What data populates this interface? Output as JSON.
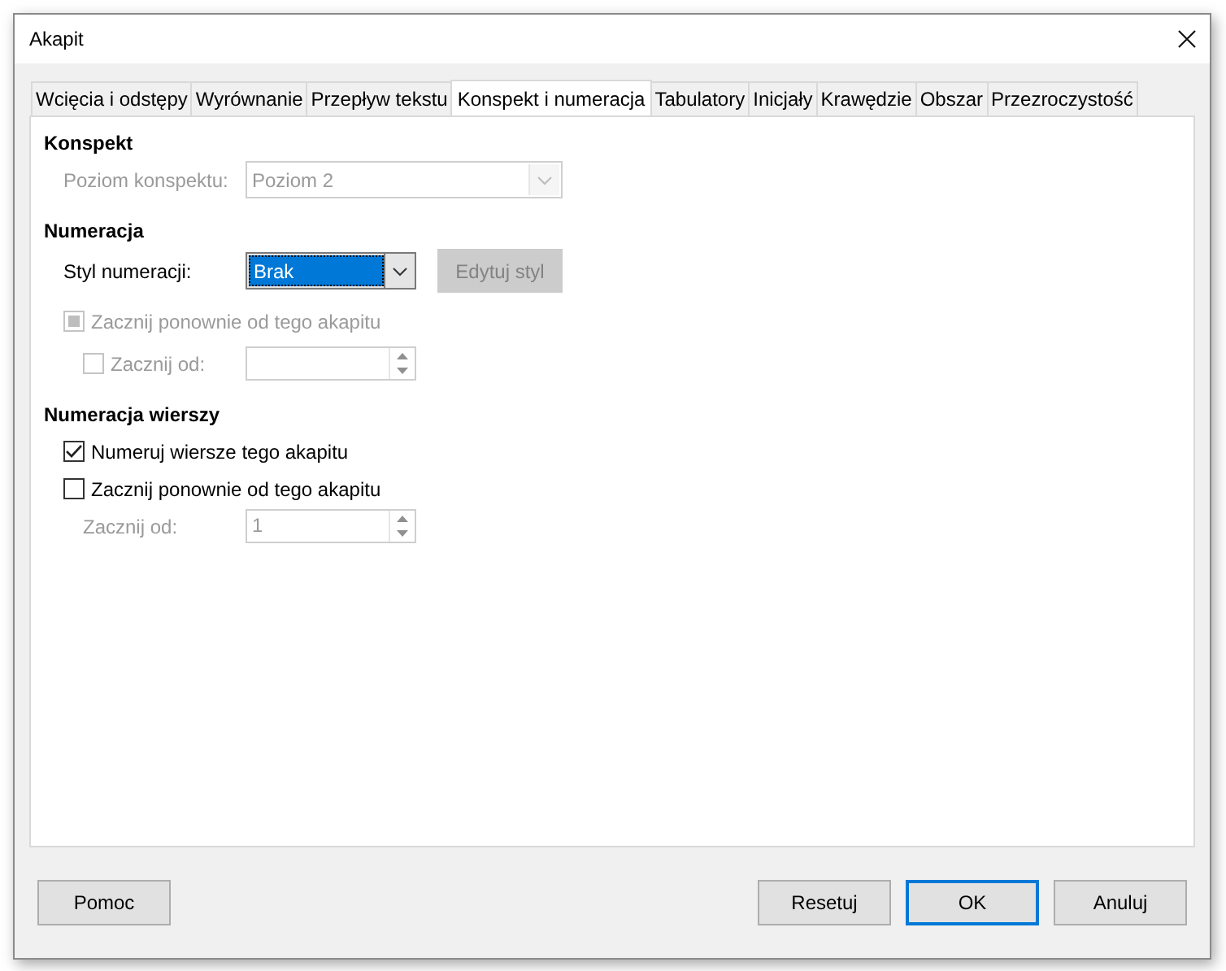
{
  "window": {
    "title": "Akapit"
  },
  "tabs": [
    {
      "label": "Wcięcia i odstępy",
      "selected": false
    },
    {
      "label": "Wyrównanie",
      "selected": false
    },
    {
      "label": "Przepływ tekstu",
      "selected": false
    },
    {
      "label": "Konspekt i numeracja",
      "selected": true
    },
    {
      "label": "Tabulatory",
      "selected": false
    },
    {
      "label": "Inicjały",
      "selected": false
    },
    {
      "label": "Krawędzie",
      "selected": false
    },
    {
      "label": "Obszar",
      "selected": false
    },
    {
      "label": "Przezroczystość",
      "selected": false
    }
  ],
  "sections": [
    {
      "heading": "Konspekt",
      "rows": [
        {
          "kind": "combo",
          "label": "Poziom konspektu:",
          "value": "Poziom 2",
          "disabled": true,
          "focused": false
        }
      ]
    },
    {
      "heading": "Numeracja",
      "rows": [
        {
          "kind": "combo",
          "label": "Styl numeracji:",
          "value": "Brak",
          "disabled": false,
          "focused": true,
          "button": {
            "label": "Edytuj styl",
            "disabled": true
          }
        },
        {
          "kind": "check",
          "label": "Zacznij ponownie od tego akapitu",
          "checked": false,
          "indeterminate": true,
          "disabled": true
        },
        {
          "kind": "checkspin",
          "label": "Zacznij od:",
          "checked": false,
          "indeterminate": false,
          "disabled": true
        }
      ]
    },
    {
      "heading": "Numeracja wierszy",
      "rows": [
        {
          "kind": "check",
          "label": "Numeruj wiersze tego akapitu",
          "checked": true,
          "indeterminate": false,
          "disabled": false
        },
        {
          "kind": "check",
          "label": "Zacznij ponownie od tego akapitu",
          "checked": false,
          "indeterminate": false,
          "disabled": false
        },
        {
          "kind": "spin",
          "label": "Zacznij od:",
          "value": "1",
          "disabled": true
        }
      ]
    }
  ],
  "left_buttons": [
    {
      "label": "Pomoc",
      "default": false
    }
  ],
  "right_buttons": [
    {
      "label": "Resetuj",
      "default": false
    },
    {
      "label": "OK",
      "default": true
    },
    {
      "label": "Anuluj",
      "default": false
    }
  ]
}
